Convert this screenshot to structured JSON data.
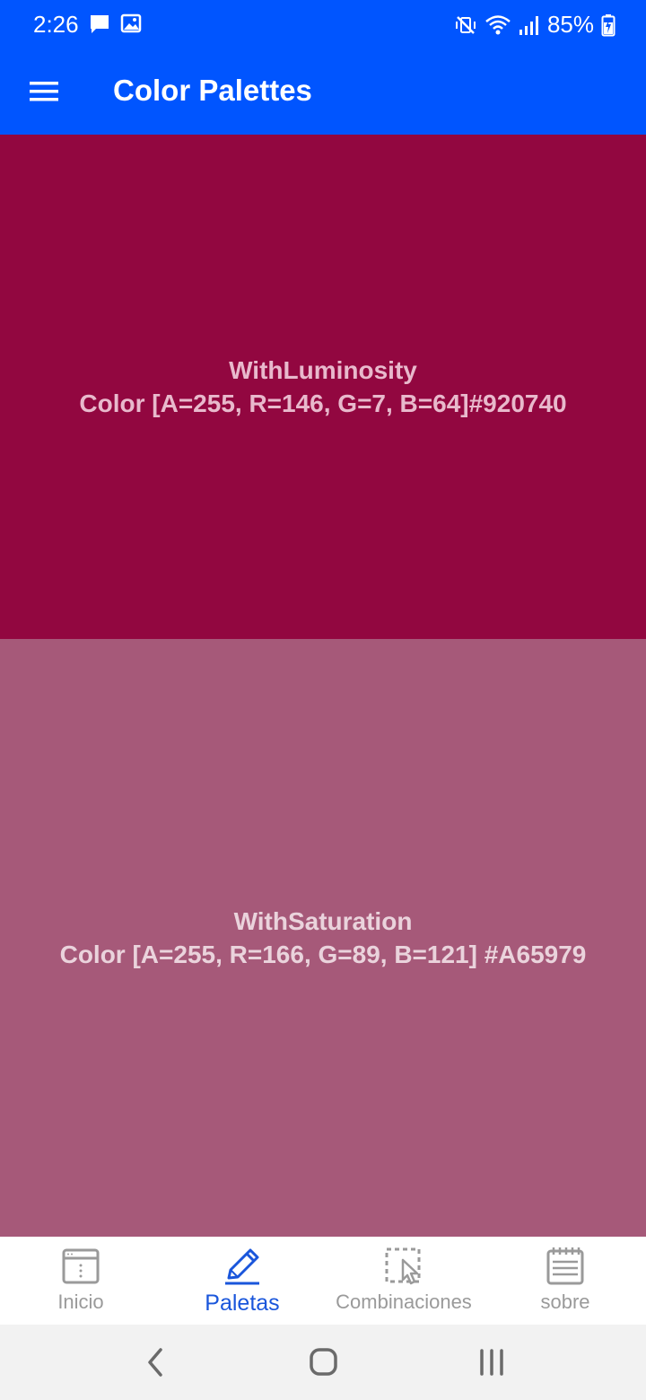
{
  "status_bar": {
    "time": "2:26",
    "battery_text": "85%",
    "icons": [
      "chat-icon",
      "image-icon",
      "mute-vibrate-icon",
      "wifi-icon",
      "signal-icon",
      "battery-charging-icon"
    ]
  },
  "app_bar": {
    "title": "Color Palettes",
    "color": "#0055ff"
  },
  "swatches": [
    {
      "name": "WithLuminosity",
      "value": "Color [A=255, R=146, G=7, B=64]#920740",
      "background": "#920740",
      "text_color": "#e8b9cc"
    },
    {
      "name": "WithSaturation",
      "value": "Color [A=255, R=166, G=89, B=121] #A65979",
      "background": "#A65979",
      "text_color": "#ead3dc"
    }
  ],
  "bottom_nav": {
    "active_color": "#1a56db",
    "inactive_color": "#9a9a9a",
    "items": [
      {
        "label": "Inicio",
        "icon": "browser-window-icon",
        "active": false
      },
      {
        "label": "Paletas",
        "icon": "pencil-icon",
        "active": true
      },
      {
        "label": "Combinaciones",
        "icon": "selection-cursor-icon",
        "active": false
      },
      {
        "label": "sobre",
        "icon": "notepad-icon",
        "active": false
      }
    ]
  },
  "system_nav": {
    "buttons": [
      "back-icon",
      "home-icon",
      "recents-icon"
    ]
  }
}
